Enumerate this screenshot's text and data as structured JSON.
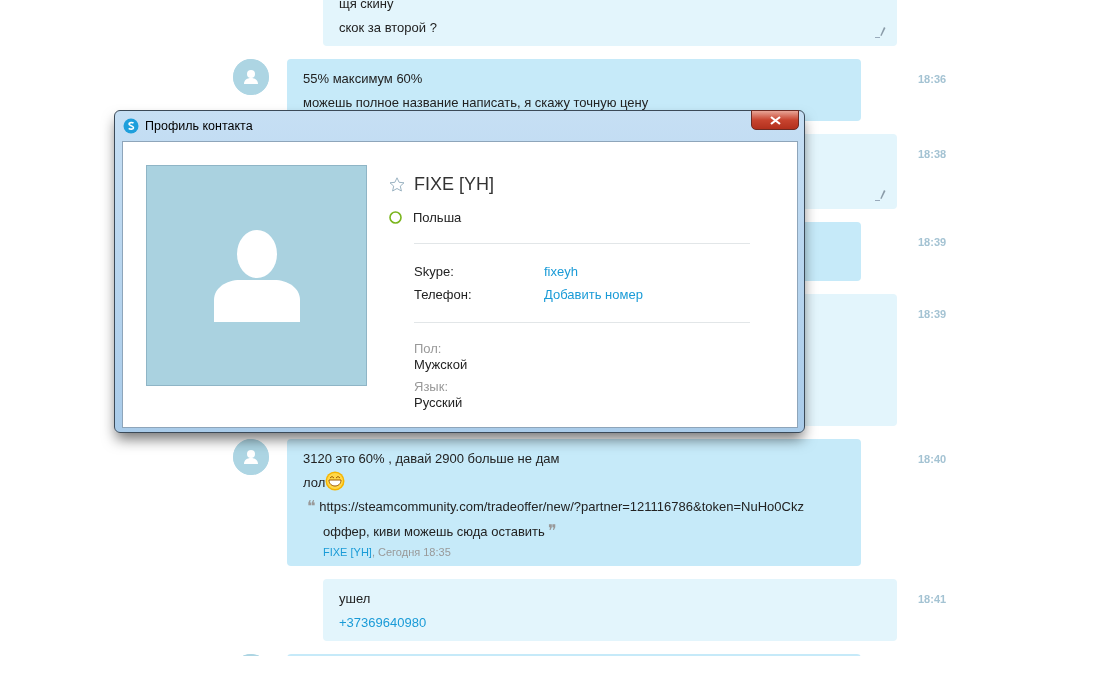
{
  "messages": [
    {
      "kind": "outgoing",
      "lines": [
        "щя скину",
        "скок за второй ?"
      ],
      "edited": true
    },
    {
      "kind": "incoming",
      "time": "18:36",
      "lines": [
        "55% максимум 60%",
        "можешь полное название написать, я скажу точную цену"
      ],
      "edited": false
    },
    {
      "kind": "outgoing",
      "time": "18:38",
      "edited": true
    },
    {
      "kind": "incoming",
      "time": "18:39",
      "edited": false
    },
    {
      "kind": "outgoing",
      "time": "18:39",
      "edited": false
    },
    {
      "kind": "incoming",
      "time": "18:40",
      "lines": [
        "3120 это 60% , давай 2900 больше не дам",
        "лол"
      ],
      "emoticon": true,
      "quote": {
        "open": "❝",
        "link": "https://steamcommunity.com/tradeoffer/new/?partner=121116786&token=NuHo0Ckz",
        "text": "оффер, киви можешь сюда оставить",
        "close": "❞",
        "author": "FIXE [YH]",
        "when": ", Сегодня 18:35"
      },
      "edited": false
    },
    {
      "kind": "outgoing",
      "time": "18:41",
      "lines": [
        "ушел"
      ],
      "phone": "+37369640980",
      "edited": false
    },
    {
      "kind": "incoming",
      "edited": false
    }
  ],
  "dialog": {
    "title": "Профиль контакта",
    "name": "FIXE [YH]",
    "favorite": false,
    "online": true,
    "location": "Польша",
    "fields": [
      {
        "label": "Skype:",
        "value": "fixeyh"
      },
      {
        "label": "Телефон:",
        "value": "Добавить номер"
      }
    ],
    "details": [
      {
        "label": "Пол:",
        "value": "Мужской"
      },
      {
        "label": "Язык:",
        "value": "Русский"
      }
    ]
  }
}
